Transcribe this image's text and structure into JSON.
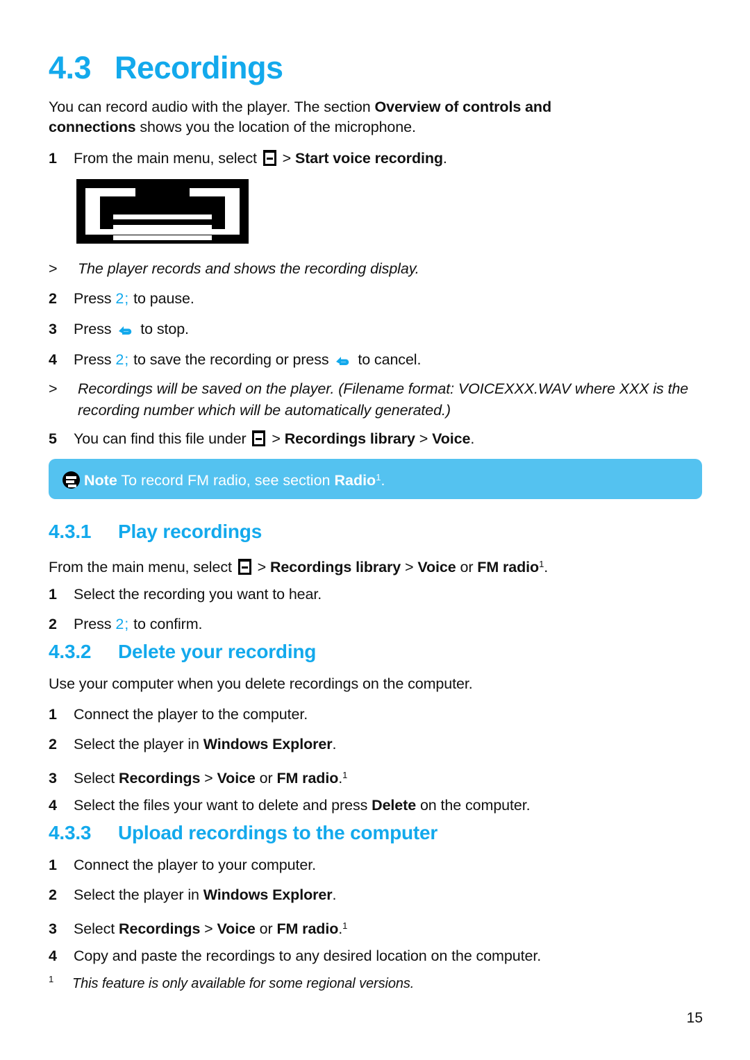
{
  "document": {
    "page_number": "15",
    "accent_color": "#13a9ec",
    "note_bar_color": "#54c2f0"
  },
  "section": {
    "number": "4.3",
    "title": "Recordings"
  },
  "intro": {
    "text_part1": "You can record audio with the player. The section ",
    "bold1": "Overview of controls and connections",
    "text_part2": " shows you the location of the microphone."
  },
  "steps_main": [
    {
      "index": "1",
      "pre": "From the main menu, select ",
      "icon": "menu-icon",
      "mid": " > ",
      "bold": "Start voice recording",
      "post": "."
    }
  ],
  "display_graphic": {
    "name": "recording-display-illustration",
    "alt": "Recording display screen illustration"
  },
  "results": [
    {
      "marker": ">",
      "text": "The player records and shows the recording display."
    },
    {
      "marker": ">",
      "text": "Recordings will be saved on the player. (Filename format: VOICEXXX.WAV where XXX is the recording number which will be automatically generated.)"
    }
  ],
  "steps_press": [
    {
      "index": "2",
      "pre": "Press ",
      "icon": "2;",
      "post": " to pause."
    },
    {
      "index": "3",
      "pre": "Press ",
      "icon": "back-arrow-icon",
      "post": " to stop."
    },
    {
      "index": "4",
      "pre": "Press ",
      "icon": "2;",
      "mid": " to save the recording or press ",
      "icon2": "back-arrow-icon",
      "post": " to cancel."
    },
    {
      "index": "5",
      "pre": "You can find this file under ",
      "icon": "menu-icon",
      "mid": " > ",
      "bold1": "Recordings library",
      "mid2": " > ",
      "bold2": "Voice",
      "post": "."
    }
  ],
  "note": {
    "icon": "note-icon",
    "label": "Note",
    "text": " To record FM radio, see section ",
    "bold": "Radio",
    "superscript": "1",
    "post": "."
  },
  "subsection_431": {
    "number": "4.3.1",
    "title": "Play recordings",
    "lead": {
      "pre": "From the main menu, select ",
      "icon": "menu-icon",
      "mid": " > ",
      "bold1": "Recordings library",
      "mid2": " > ",
      "bold2": "Voice",
      "mid3": " or ",
      "bold3": "FM radio",
      "superscript": "1",
      "post": "."
    },
    "steps": [
      {
        "index": "1",
        "text": "Select the recording you want to hear."
      },
      {
        "index": "2",
        "pre": "Press ",
        "icon": "2;",
        "post": " to confirm."
      }
    ]
  },
  "subsection_432": {
    "number": "4.3.2",
    "title": "Delete your recording",
    "lead": "Use your computer when you delete recordings on the computer.",
    "steps": [
      {
        "index": "1",
        "text": "Connect the player to the computer."
      },
      {
        "index": "2",
        "pre": "Select the player in ",
        "bold": "Windows Explorer",
        "post": "."
      },
      {
        "index": "3",
        "pre": "Select ",
        "bold1": "Recordings",
        "mid1": " > ",
        "bold2": "Voice",
        "mid2": " or ",
        "bold3": "FM radio",
        "post": ".",
        "superscript": "1"
      },
      {
        "index": "4",
        "pre": "Select the files your want to delete and press ",
        "bold": "Delete",
        "post": " on the computer."
      }
    ]
  },
  "subsection_433": {
    "number": "4.3.3",
    "title": "Upload recordings to the computer",
    "steps": [
      {
        "index": "1",
        "text": "Connect the player to your computer."
      },
      {
        "index": "2",
        "pre": "Select the player in ",
        "bold": "Windows Explorer",
        "post": "."
      },
      {
        "index": "3",
        "pre": "Select ",
        "bold1": "Recordings",
        "mid1": " > ",
        "bold2": "Voice",
        "mid2": " or ",
        "bold3": "FM radio",
        "post": ".",
        "superscript": "1"
      },
      {
        "index": "4",
        "text": "Copy and paste the recordings to any desired location on the computer."
      }
    ]
  },
  "footnote": {
    "marker": "1",
    "text": "This feature is only available for some regional versions."
  }
}
